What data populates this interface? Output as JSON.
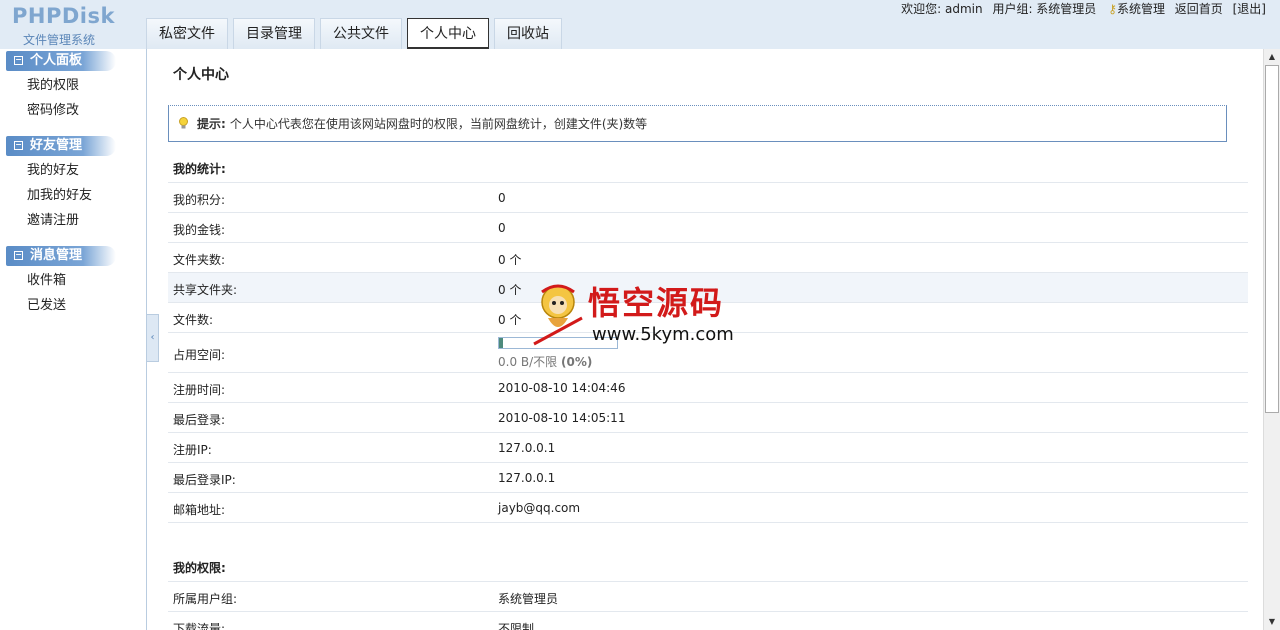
{
  "logo": {
    "main": "PHPDisk",
    "sub": "文件管理系统"
  },
  "tabs": [
    {
      "label": "私密文件",
      "active": false
    },
    {
      "label": "目录管理",
      "active": false
    },
    {
      "label": "公共文件",
      "active": false
    },
    {
      "label": "个人中心",
      "active": true
    },
    {
      "label": "回收站",
      "active": false
    }
  ],
  "userbar": {
    "welcome": "欢迎您: admin",
    "group": "用户组: 系统管理员",
    "admin": "系统管理",
    "home": "返回首页",
    "logout": "[退出]"
  },
  "sidebar": {
    "sections": [
      {
        "title": "个人面板",
        "items": [
          "我的权限",
          "密码修改"
        ]
      },
      {
        "title": "好友管理",
        "items": [
          "我的好友",
          "加我的好友",
          "邀请注册"
        ]
      },
      {
        "title": "消息管理",
        "items": [
          "收件箱",
          "已发送"
        ]
      }
    ]
  },
  "main": {
    "title": "个人中心",
    "tip": {
      "label": "提示:",
      "text": "个人中心代表您在使用该网站网盘时的权限，当前网盘统计，创建文件(夹)数等"
    },
    "stats_title": "我的统计:",
    "stats": {
      "points_label": "我的积分:",
      "points": "0",
      "money_label": "我的金钱:",
      "money": "0",
      "folders_label": "文件夹数:",
      "folders": "0 个",
      "shared_label": "共享文件夹:",
      "shared": "0 个",
      "files_label": "文件数:",
      "files": "0 个",
      "space_label": "占用空间:",
      "space_text": "0.0 B/不限",
      "space_percent_text": "(0%)",
      "space_fraction": 0,
      "regtime_label": "注册时间:",
      "regtime": "2010-08-10 14:04:46",
      "lastlogin_label": "最后登录:",
      "lastlogin": "2010-08-10 14:05:11",
      "regip_label": "注册IP:",
      "regip": "127.0.0.1",
      "lastip_label": "最后登录IP:",
      "lastip": "127.0.0.1",
      "email_label": "邮箱地址:",
      "email": "jayb@qq.com"
    },
    "perm_title": "我的权限:",
    "perms": {
      "group_label": "所属用户组:",
      "group": "系统管理员",
      "download_label": "下载流量:",
      "download": "不限制"
    }
  },
  "watermark": {
    "title": "悟空源码",
    "url": "www.5kym.com"
  }
}
